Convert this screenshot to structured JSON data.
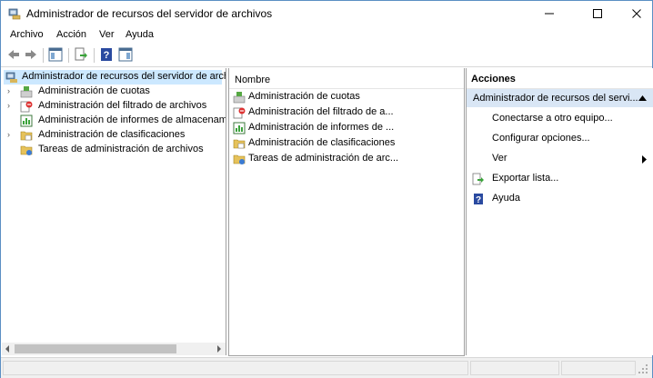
{
  "window": {
    "title": "Administrador de recursos del servidor de archivos"
  },
  "menu": [
    "Archivo",
    "Acción",
    "Ver",
    "Ayuda"
  ],
  "tree": {
    "root": "Administrador de recursos del servidor de arch",
    "items": [
      "Administración de cuotas",
      "Administración del filtrado de archivos",
      "Administración de informes de almacenam",
      "Administración de clasificaciones",
      "Tareas de administración de archivos"
    ]
  },
  "list": {
    "column_header": "Nombre",
    "items": [
      "Administración de cuotas",
      "Administración del filtrado de a...",
      "Administración de informes de ...",
      "Administración de clasificaciones",
      "Tareas de administración de arc..."
    ]
  },
  "actions": {
    "title": "Acciones",
    "section": "Administrador de recursos del servi...",
    "items": [
      "Conectarse a otro equipo...",
      "Configurar opciones...",
      "Ver",
      "Exportar lista...",
      "Ayuda"
    ]
  },
  "colors": {
    "selection": "#cce8ff",
    "section_header": "#d9e6f5",
    "pane_header": "#e8e8e8"
  },
  "icons": [
    "back-arrow-icon",
    "forward-arrow-icon",
    "console-tree-icon",
    "export-list-icon",
    "help-icon",
    "show-action-pane-icon"
  ]
}
